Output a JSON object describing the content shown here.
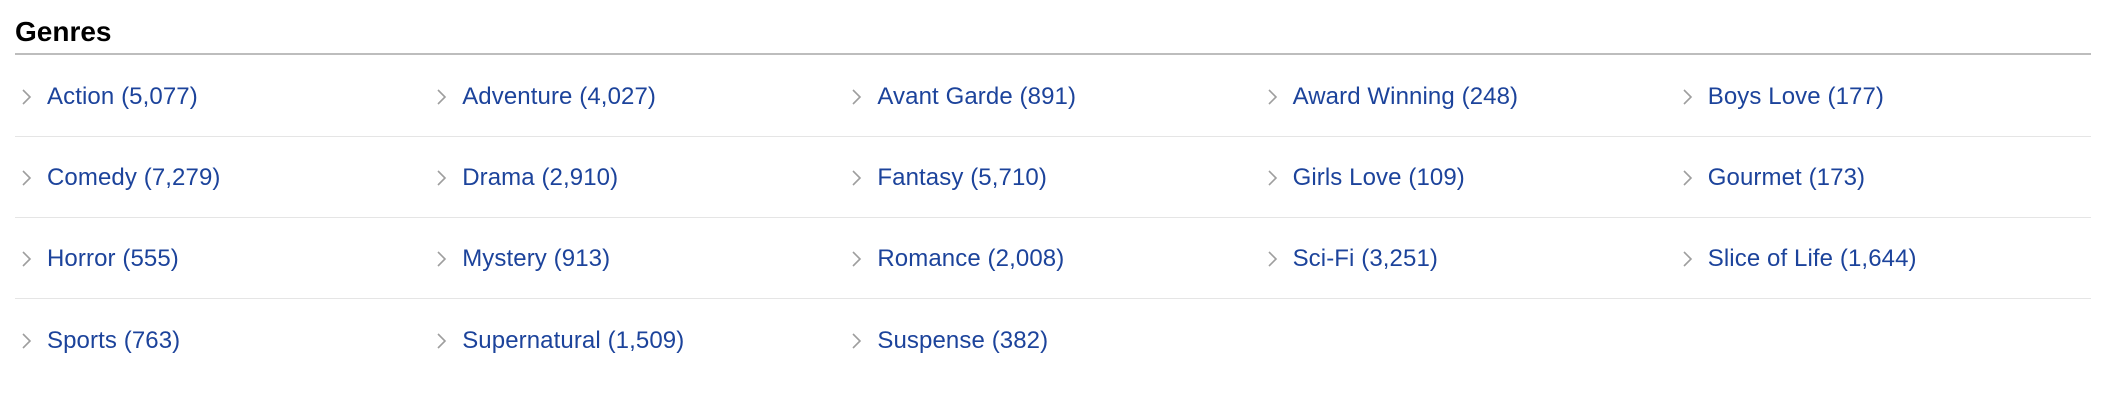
{
  "section": {
    "title": "Genres"
  },
  "colors": {
    "link": "#1c439b",
    "chevron": "#9e9e9e",
    "rule": "#bdbdbd",
    "row_divider": "#e5e5e5"
  },
  "icons": {
    "chevron": "chevron-right-icon"
  },
  "genres": [
    [
      "Action (5,077)",
      "Adventure (4,027)",
      "Avant Garde (891)",
      "Award Winning (248)",
      "Boys Love (177)"
    ],
    [
      "Comedy (7,279)",
      "Drama (2,910)",
      "Fantasy (5,710)",
      "Girls Love (109)",
      "Gourmet (173)"
    ],
    [
      "Horror (555)",
      "Mystery (913)",
      "Romance (2,008)",
      "Sci-Fi (3,251)",
      "Slice of Life (1,644)"
    ],
    [
      "Sports (763)",
      "Supernatural (1,509)",
      "Suspense (382)"
    ]
  ]
}
